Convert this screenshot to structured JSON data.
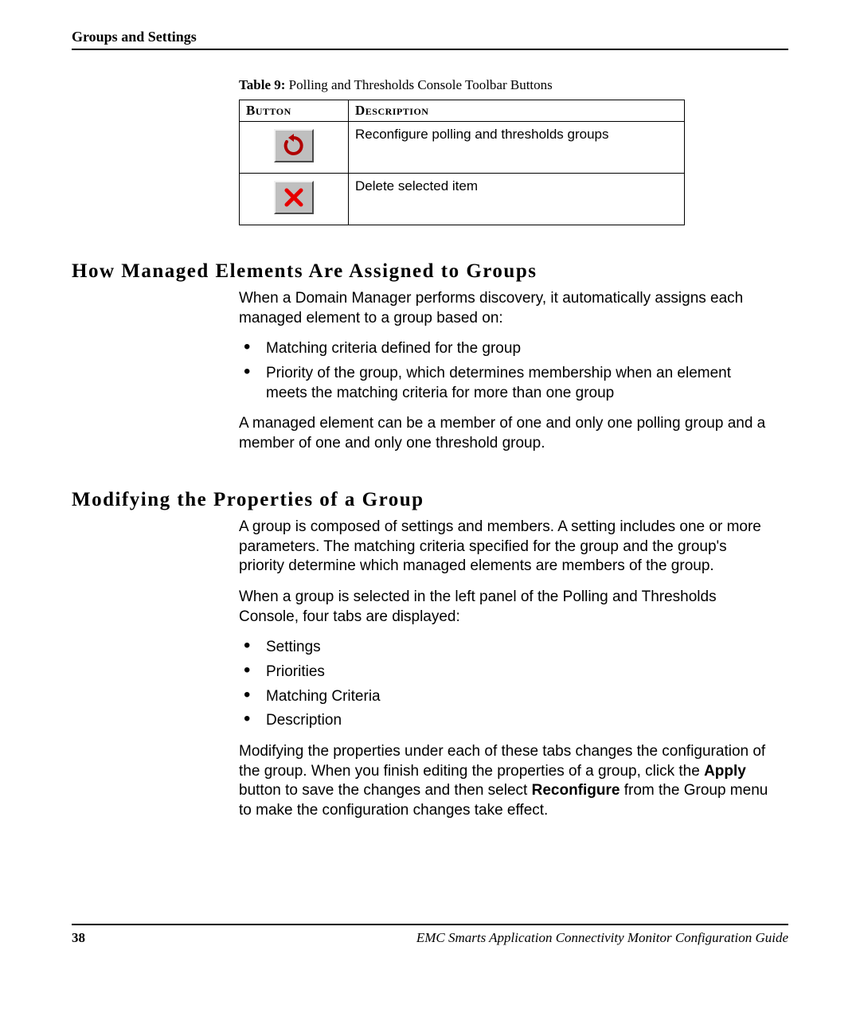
{
  "header": {
    "title": "Groups and Settings"
  },
  "table": {
    "caption_label": "Table 9:",
    "caption_text": "Polling and Thresholds Console Toolbar Buttons",
    "headers": {
      "button": "Button",
      "description": "Description"
    },
    "rows": [
      {
        "icon": "arrow-reload-icon",
        "desc": "Reconfigure polling and thresholds groups"
      },
      {
        "icon": "x-delete-icon",
        "desc": "Delete selected item"
      }
    ]
  },
  "section1": {
    "title": "How Managed Elements Are Assigned to Groups",
    "p1": "When a Domain Manager performs discovery, it automatically assigns each managed element to a group based on:",
    "bullets": [
      "Matching criteria defined for the group",
      "Priority of the group, which determines membership when an element meets the matching criteria for more than one group"
    ],
    "p2": "A managed element can be a member of one and only one polling group and a member of one and only one threshold group."
  },
  "section2": {
    "title": "Modifying the Properties of a Group",
    "p1": "A group is composed of settings and members. A setting includes one or more parameters. The matching criteria specified for the group and the group's priority determine which managed elements are members of the group.",
    "p2": "When a group is selected in the left panel of the Polling and Thresholds Console, four tabs are displayed:",
    "bullets": [
      "Settings",
      "Priorities",
      "Matching Criteria",
      "Description"
    ],
    "p3_a": "Modifying the properties under each of these tabs changes the configuration of the group. When you finish editing the properties of a group, click the ",
    "p3_bold1": "Apply",
    "p3_b": " button to save the changes and then select ",
    "p3_bold2": "Reconfigure",
    "p3_c": " from the Group menu to make the configuration changes take effect."
  },
  "footer": {
    "page": "38",
    "doc": "EMC Smarts Application Connectivity Monitor Configuration Guide"
  }
}
